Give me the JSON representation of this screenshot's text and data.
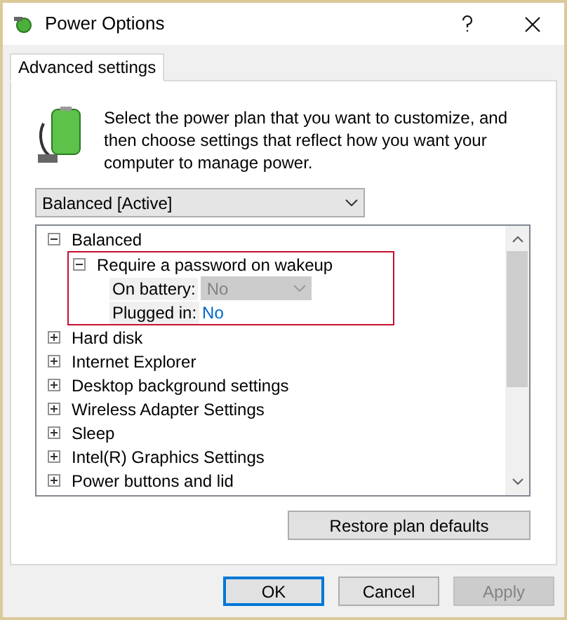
{
  "window": {
    "title": "Power Options"
  },
  "tabs": [
    {
      "label": "Advanced settings",
      "selected": true
    }
  ],
  "description": "Select the power plan that you want to customize, and then choose settings that reflect how you want your computer to manage power.",
  "plan_select": {
    "value": "Balanced [Active]"
  },
  "settings_tree": [
    {
      "label": "Balanced",
      "expanded": true,
      "children": [
        {
          "label": "Require a password on wakeup",
          "expanded": true,
          "highlighted": true,
          "children": [
            {
              "kind": "setting",
              "label": "On battery:",
              "value": "No",
              "disabled": true
            },
            {
              "kind": "setting",
              "label": "Plugged in:",
              "value": "No",
              "disabled": false
            }
          ]
        }
      ]
    },
    {
      "label": "Hard disk",
      "expanded": false
    },
    {
      "label": "Internet Explorer",
      "expanded": false
    },
    {
      "label": "Desktop background settings",
      "expanded": false
    },
    {
      "label": "Wireless Adapter Settings",
      "expanded": false
    },
    {
      "label": "Sleep",
      "expanded": false
    },
    {
      "label": "Intel(R) Graphics Settings",
      "expanded": false
    },
    {
      "label": "Power buttons and lid",
      "expanded": false
    }
  ],
  "restore_button": {
    "label": "Restore plan defaults"
  },
  "buttons": [
    {
      "label": "OK",
      "default": true,
      "disabled": false
    },
    {
      "label": "Cancel",
      "default": false,
      "disabled": false
    },
    {
      "label": "Apply",
      "default": false,
      "disabled": true
    }
  ]
}
